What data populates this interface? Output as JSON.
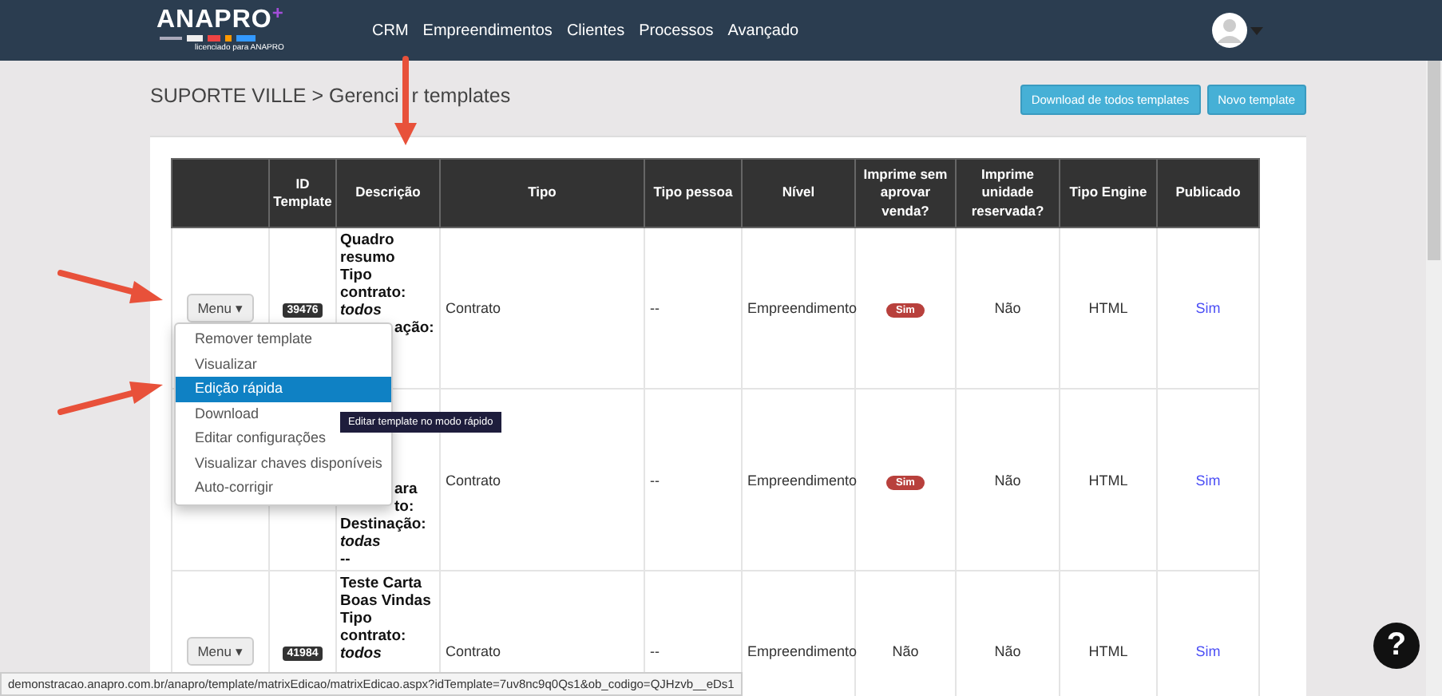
{
  "navbar": {
    "logo": "ANAPRO",
    "logo_plus": "+",
    "licensed": "licenciado para ANAPRO",
    "menu": [
      {
        "label": "CRM"
      },
      {
        "label": "Empreendimentos"
      },
      {
        "label": "Clientes"
      },
      {
        "label": "Processos"
      },
      {
        "label": "Avançado"
      }
    ]
  },
  "breadcrumb": [
    "SUPORTE VILLE > Gerenci",
    "r templates"
  ],
  "actions": [
    {
      "label": "Download de todos templates"
    },
    {
      "label": "Novo template"
    }
  ],
  "table": {
    "columns": [
      "",
      "ID Template",
      "Descrição",
      "Tipo",
      "Tipo pessoa",
      "Nível",
      "Imprime sem aprovar venda?",
      "Imprime unidade reservada?",
      "Tipo Engine",
      "Publicado"
    ],
    "rows": [
      {
        "menu": "Menu ▾",
        "id": "39476",
        "description": [
          {
            "text": "Quadro resumo",
            "italic": false,
            "covered": false
          },
          {
            "text": "Tipo contrato:",
            "italic": false,
            "covered": false
          },
          {
            "text": "todos",
            "italic": true,
            "covered": false
          },
          {
            "text": "ação:",
            "italic": false,
            "covered": true
          }
        ],
        "tipo": "Contrato",
        "tipo_pessoa": "--",
        "nivel": "Empreendimento",
        "imprime_sem": {
          "text": "Sim",
          "kind": "badge"
        },
        "imprime_unidade": "Não",
        "engine": "HTML",
        "publicado": "Sim"
      },
      {
        "menu": null,
        "id": null,
        "description": [
          {
            "text": "ara",
            "italic": false,
            "covered": true
          },
          {
            "text": "to:",
            "italic": false,
            "covered": true
          },
          {
            "text": "Destinação:",
            "italic": false,
            "covered": false
          },
          {
            "text": "todas",
            "italic": true,
            "covered": false
          },
          {
            "text": "--",
            "italic": false,
            "covered": false
          }
        ],
        "tipo": "Contrato",
        "tipo_pessoa": "--",
        "nivel": "Empreendimento",
        "imprime_sem": {
          "text": "Sim",
          "kind": "badge"
        },
        "imprime_unidade": "Não",
        "engine": "HTML",
        "publicado": "Sim"
      },
      {
        "menu": "Menu ▾",
        "id": "41984",
        "description": [
          {
            "text": "Teste Carta Boas Vindas",
            "italic": false,
            "covered": false
          },
          {
            "text": "Tipo contrato:",
            "italic": false,
            "covered": false
          },
          {
            "text": "todos",
            "italic": true,
            "covered": false
          }
        ],
        "tipo": "Contrato",
        "tipo_pessoa": "--",
        "nivel": "Empreendimento",
        "imprime_sem": {
          "text": "Não",
          "kind": "plain"
        },
        "imprime_unidade": "Não",
        "engine": "HTML",
        "publicado": "Sim"
      }
    ]
  },
  "dropdown": {
    "items": [
      {
        "label": "Remover template",
        "selected": false
      },
      {
        "label": "Visualizar",
        "selected": false
      },
      {
        "label": "Edição rápida",
        "selected": true
      },
      {
        "label": "Download",
        "selected": false
      },
      {
        "label": "Editar configurações",
        "selected": false
      },
      {
        "label": "Visualizar chaves disponíveis",
        "selected": false
      },
      {
        "label": "Auto-corrigir",
        "selected": false
      }
    ]
  },
  "tooltip": "Editar template no modo rápido",
  "status_bar": "demonstracao.anapro.com.br/anapro/template/matrixEdicao/matrixEdicao.aspx?idTemplate=7uv8nc9q0Qs1&ob_codigo=QJHzvb__eDs1",
  "help_button": "?"
}
